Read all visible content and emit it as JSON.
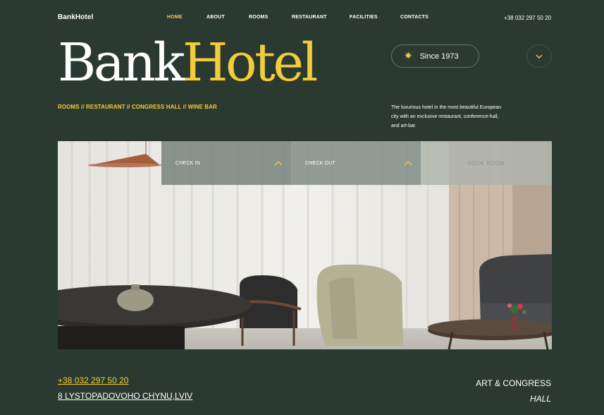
{
  "header": {
    "logo": "BankHotel",
    "nav": [
      {
        "label": "HOME",
        "active": true
      },
      {
        "label": "ABOUT",
        "active": false
      },
      {
        "label": "ROOMS",
        "active": false
      },
      {
        "label": "RESTAURANT",
        "active": false
      },
      {
        "label": "FACILITIES",
        "active": false
      },
      {
        "label": "CONTACTS",
        "active": false
      }
    ],
    "phone": "+38 032 297 50 20"
  },
  "hero": {
    "brand_part1": "Bank",
    "brand_part2": "Hotel",
    "since_label": "Since 1973",
    "since_icon": "sun-star-icon",
    "scroll_icon": "chevron-down-icon",
    "links": "ROOMS // RESTAURANT // CONGRESS HALL // WINE BAR",
    "description": "The luxurious hotel in the most beautiful European city with an exclusive restaurant, conference-hall, and art-bar."
  },
  "booking": {
    "check_in": "CHECK IN",
    "check_out": "CHECK OUT",
    "book_room": "BOOK ROOM",
    "toggle_icon": "chevron-up-icon"
  },
  "footer": {
    "phone": "+38 032 297 50 20",
    "address": "8 LYSTOPADOVOHO CHYNU,LVIV",
    "right_line1": "ART & CONGRESS",
    "right_line2": "HALL"
  },
  "colors": {
    "background": "#2b3a31",
    "accent": "#f2cc3a",
    "text": "#ffffff"
  }
}
